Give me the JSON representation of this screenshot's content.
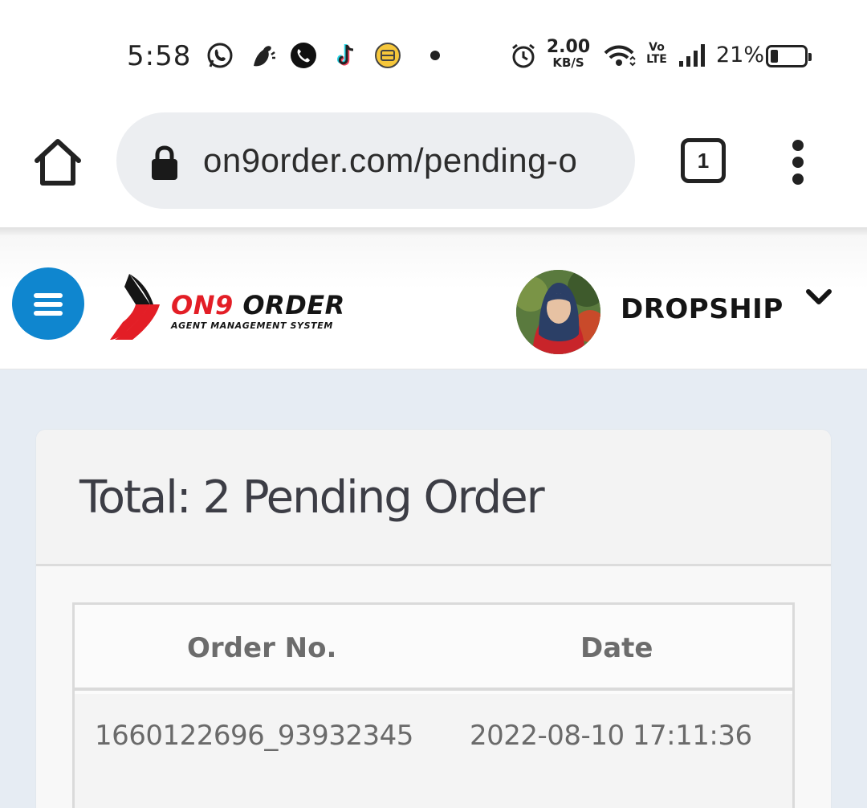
{
  "status_bar": {
    "time": "5:58",
    "notification_icons": [
      "whatsapp-icon",
      "messenger-style-icon",
      "phone-call-icon",
      "tiktok-icon",
      "shopee-icon"
    ],
    "net_speed_value": "2.00",
    "net_speed_unit": "KB/S",
    "volte_top": "Vo",
    "volte_bottom": "LTE",
    "battery_percent": "21%",
    "battery_level": 0.21
  },
  "browser": {
    "url": "on9order.com/pending-o",
    "tab_count": "1"
  },
  "app_header": {
    "logo": {
      "title_part1": "ON9",
      "title_part2": " ORDER",
      "subtitle": "AGENT MANAGEMENT SYSTEM"
    },
    "user_role": "DROPSHIP",
    "colors": {
      "menu_button": "#0f86cf",
      "brand_red": "#e31e26"
    }
  },
  "card": {
    "title": "Total: 2 Pending Order",
    "table": {
      "headers": [
        "Order No.",
        "Date"
      ],
      "rows": [
        [
          "1660122696_93932345",
          "2022-08-10 17:11:36"
        ]
      ]
    }
  }
}
